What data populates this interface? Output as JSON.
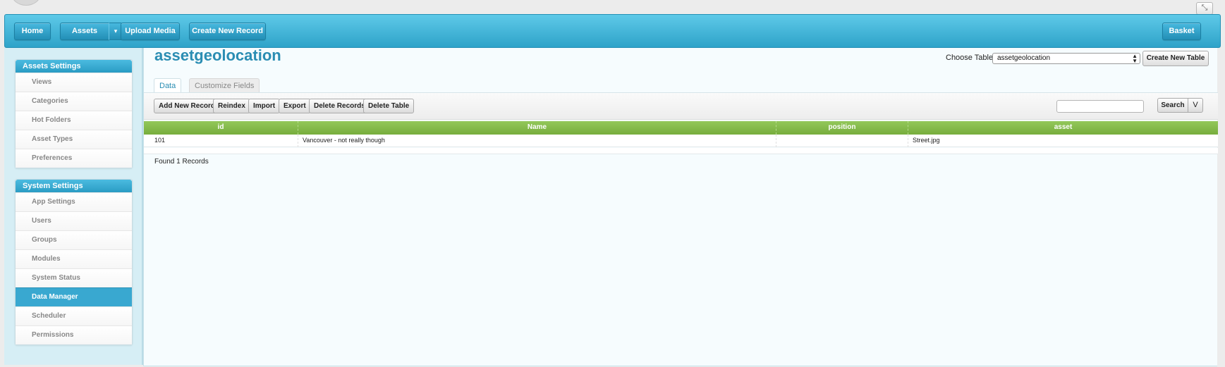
{
  "nav": {
    "home": "Home",
    "assets": "Assets",
    "assets_caret": "▾",
    "upload": "Upload Media",
    "create_record": "Create New Record",
    "basket": "Basket"
  },
  "sidebar": {
    "assets_settings": {
      "title": "Assets Settings",
      "items": [
        {
          "label": "Views"
        },
        {
          "label": "Categories"
        },
        {
          "label": "Hot Folders"
        },
        {
          "label": "Asset Types"
        },
        {
          "label": "Preferences"
        }
      ]
    },
    "system_settings": {
      "title": "System Settings",
      "items": [
        {
          "label": "App Settings"
        },
        {
          "label": "Users"
        },
        {
          "label": "Groups"
        },
        {
          "label": "Modules"
        },
        {
          "label": "System Status"
        },
        {
          "label": "Data Manager",
          "active": true
        },
        {
          "label": "Scheduler"
        },
        {
          "label": "Permissions"
        }
      ]
    }
  },
  "main": {
    "title": "assetgeolocation",
    "choose_table_label": "Choose Table:",
    "choose_table_value": "assetgeolocation",
    "create_table_button": "Create New Table",
    "tabs": [
      {
        "label": "Data",
        "active": true
      },
      {
        "label": "Customize Fields",
        "active": false
      }
    ],
    "toolbar": {
      "add": "Add New Record",
      "reindex": "Reindex",
      "import": "Import",
      "export": "Export",
      "delete_records": "Delete Records",
      "delete_table": "Delete Table",
      "search_value": "",
      "search_button": "Search",
      "search_more": "V"
    },
    "table": {
      "columns": [
        "id",
        "Name",
        "position",
        "asset"
      ],
      "rows": [
        [
          "101",
          "Vancouver - not really though",
          "",
          "Street.jpg"
        ]
      ]
    },
    "found_text": "Found 1 Records"
  },
  "colors": {
    "accent": "#2ea3c9",
    "title": "#2a8db3",
    "grid_header": "#85bb4b"
  }
}
